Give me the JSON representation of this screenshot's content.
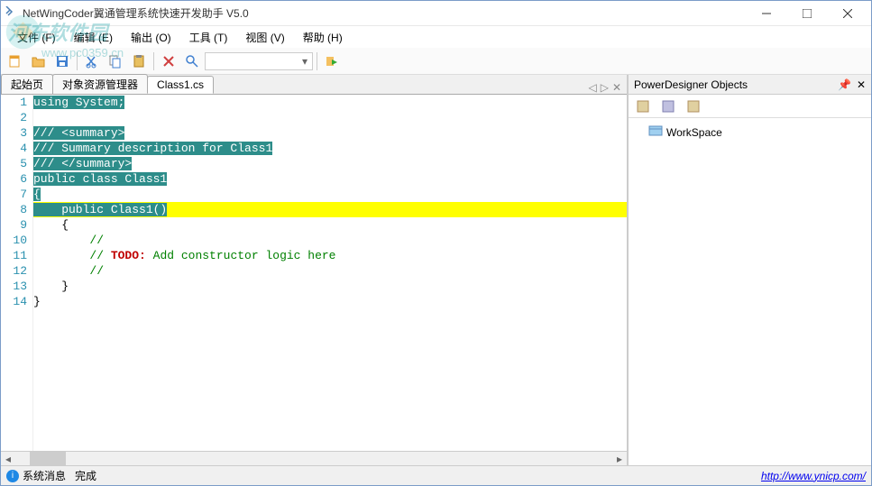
{
  "title": "NetWingCoder翼通管理系统快速开发助手 V5.0",
  "watermark": {
    "text": "河东软件园",
    "url": "www.pc0359.cn"
  },
  "menu": {
    "file": "文件 (F)",
    "edit": "编辑 (E)",
    "output": "输出 (O)",
    "tools": "工具 (T)",
    "view": "视图 (V)",
    "help": "帮助 (H)"
  },
  "tabs": {
    "start": "起始页",
    "explorer": "对象资源管理器",
    "active": "Class1.cs"
  },
  "code": {
    "lines": [
      "1",
      "2",
      "3",
      "4",
      "5",
      "6",
      "7",
      "8",
      "9",
      "10",
      "11",
      "12",
      "13",
      "14"
    ],
    "l1": "using System;",
    "l3": "/// <summary>",
    "l4": "/// Summary description for Class1",
    "l5": "/// </summary>",
    "l6": "public class Class1",
    "l7": "{",
    "l8a": "    public Class1",
    "l8b": "()",
    "l9": "    {",
    "l10": "        //",
    "l11a": "        // ",
    "l11b": "TODO:",
    "l11c": " Add constructor logic here",
    "l12": "        //",
    "l13": "    }",
    "l14": "}"
  },
  "panel": {
    "title": "PowerDesigner Objects",
    "tree_root": "WorkSpace"
  },
  "status": {
    "messages": "系统消息",
    "done": "完成",
    "link": "http://www.ynicp.com/"
  }
}
